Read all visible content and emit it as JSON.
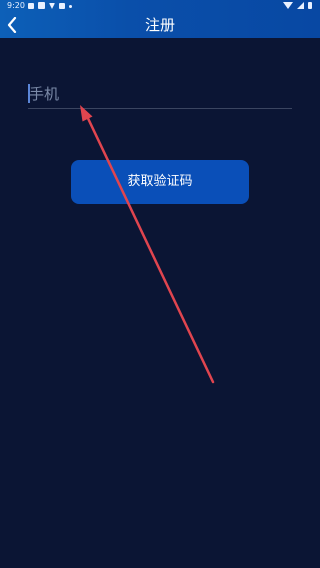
{
  "status_bar": {
    "time": "9:20",
    "left_icons": [
      "image-icon",
      "app-icon",
      "download-icon",
      "screenshot-icon",
      "dot-icon"
    ],
    "right_icons": [
      "wifi-icon",
      "signal-icon",
      "battery-icon"
    ]
  },
  "app_bar": {
    "title": "注册",
    "back_icon": "chevron-left-icon"
  },
  "form": {
    "phone_placeholder": "手机",
    "phone_value": ""
  },
  "actions": {
    "get_code_label": "获取验证码"
  },
  "colors": {
    "background": "#0b1534",
    "app_bar": "#0a4faa",
    "button": "#0a4fb8",
    "annotation_arrow": "#e0454f"
  }
}
